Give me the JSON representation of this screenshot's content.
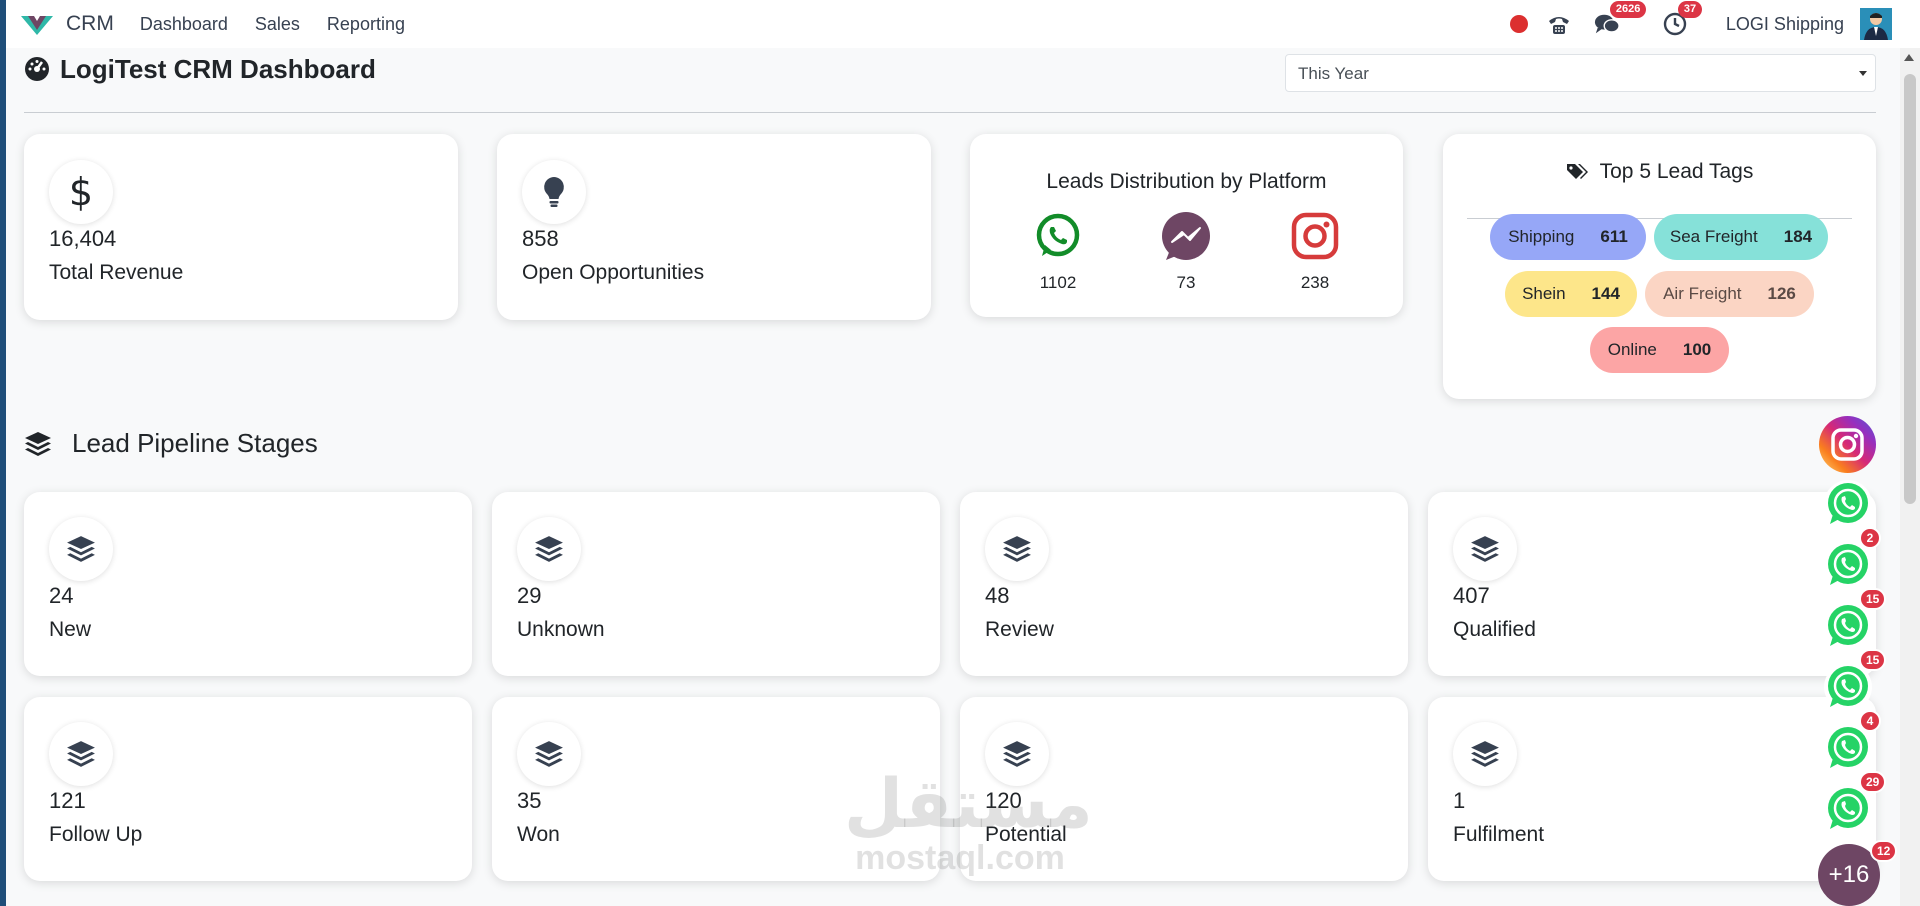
{
  "navbar": {
    "app_name": "CRM",
    "menu": [
      "Dashboard",
      "Sales",
      "Reporting"
    ],
    "chat_badge": "2626",
    "activity_badge": "37",
    "company": "LOGI Shipping"
  },
  "header": {
    "title": "LogiTest CRM Dashboard",
    "period": "This Year"
  },
  "kpis": [
    {
      "value": "16,404",
      "label": "Total Revenue",
      "icon": "dollar-icon"
    },
    {
      "value": "858",
      "label": "Open Opportunities",
      "icon": "lightbulb-icon"
    }
  ],
  "platforms": {
    "title": "Leads Distribution by Platform",
    "items": [
      {
        "name": "whatsapp",
        "count": "1102",
        "color": "#128c29"
      },
      {
        "name": "messenger",
        "count": "73",
        "color": "#6e4664"
      },
      {
        "name": "instagram",
        "count": "238",
        "color": "#d63b3b"
      }
    ]
  },
  "tags": {
    "title": "Top 5 Lead Tags",
    "items": [
      {
        "name": "Shipping",
        "count": "611",
        "color": "#96a7f7"
      },
      {
        "name": "Sea Freight",
        "count": "184",
        "color": "#86e1d9"
      },
      {
        "name": "Shein",
        "count": "144",
        "color": "#fde68a"
      },
      {
        "name": "Air Freight",
        "count": "126",
        "color": "#fbd5c4"
      },
      {
        "name": "Online",
        "count": "100",
        "color": "#fca5a5"
      }
    ]
  },
  "pipeline": {
    "title": "Lead Pipeline Stages",
    "stages": [
      {
        "count": "24",
        "name": "New"
      },
      {
        "count": "29",
        "name": "Unknown"
      },
      {
        "count": "48",
        "name": "Review"
      },
      {
        "count": "407",
        "name": "Qualified"
      },
      {
        "count": "121",
        "name": "Follow Up"
      },
      {
        "count": "35",
        "name": "Won"
      },
      {
        "count": "120",
        "name": "Potential"
      },
      {
        "count": "1",
        "name": "Fulfilment"
      }
    ]
  },
  "floating": {
    "badges": [
      "2",
      "15",
      "15",
      "4",
      "29",
      "12"
    ],
    "more": "+16"
  },
  "watermark": {
    "ar": "مستقل",
    "en": "mostaql.com"
  }
}
